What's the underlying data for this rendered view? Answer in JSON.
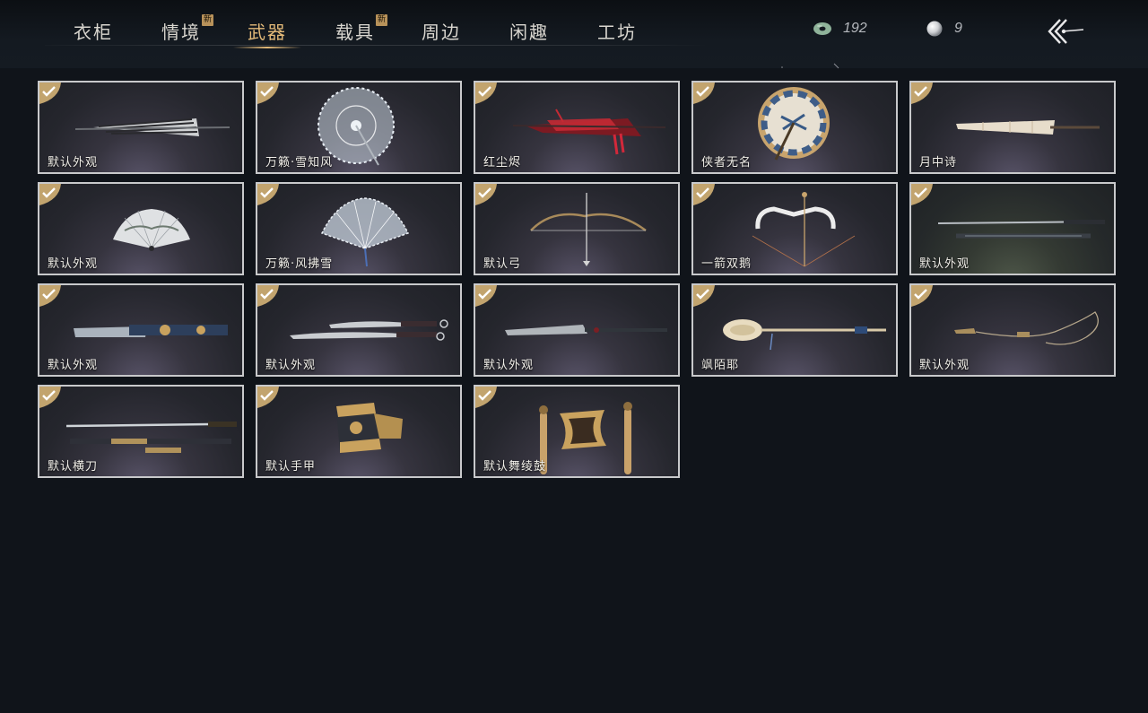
{
  "tabs": [
    {
      "label": "衣柜",
      "new": false,
      "badge": ""
    },
    {
      "label": "情境",
      "new": true,
      "badge": "新"
    },
    {
      "label": "武器",
      "new": false,
      "badge": "",
      "active": true
    },
    {
      "label": "载具",
      "new": true,
      "badge": "新"
    },
    {
      "label": "周边",
      "new": false,
      "badge": ""
    },
    {
      "label": "闲趣",
      "new": false,
      "badge": ""
    },
    {
      "label": "工坊",
      "new": false,
      "badge": ""
    }
  ],
  "currency": {
    "jade": "192",
    "pearl": "9"
  },
  "items": [
    {
      "name": "默认外观",
      "icon": "closed-umbrella-icon"
    },
    {
      "name": "万籁·雪知风",
      "icon": "lace-umbrella-icon"
    },
    {
      "name": "红尘烬",
      "icon": "red-umbrella-icon"
    },
    {
      "name": "侠者无名",
      "icon": "shield-umbrella-icon"
    },
    {
      "name": "月中诗",
      "icon": "paper-umbrella-icon"
    },
    {
      "name": "默认外观",
      "icon": "folding-fan-icon"
    },
    {
      "name": "万籁·风拂雪",
      "icon": "lace-fan-icon"
    },
    {
      "name": "默认弓",
      "icon": "bow-icon"
    },
    {
      "name": "一箭双鹅",
      "icon": "swan-bow-icon"
    },
    {
      "name": "默认外观",
      "icon": "twin-swords-icon"
    },
    {
      "name": "默认外观",
      "icon": "spear-icon"
    },
    {
      "name": "默认外观",
      "icon": "twin-blades-icon"
    },
    {
      "name": "默认外观",
      "icon": "long-blade-icon"
    },
    {
      "name": "飒陌耶",
      "icon": "ladle-staff-icon"
    },
    {
      "name": "默认外观",
      "icon": "rope-dart-icon"
    },
    {
      "name": "默认横刀",
      "icon": "hengdao-sword-icon"
    },
    {
      "name": "默认手甲",
      "icon": "gauntlet-icon"
    },
    {
      "name": "默认舞绫鼓",
      "icon": "drum-icon"
    }
  ]
}
